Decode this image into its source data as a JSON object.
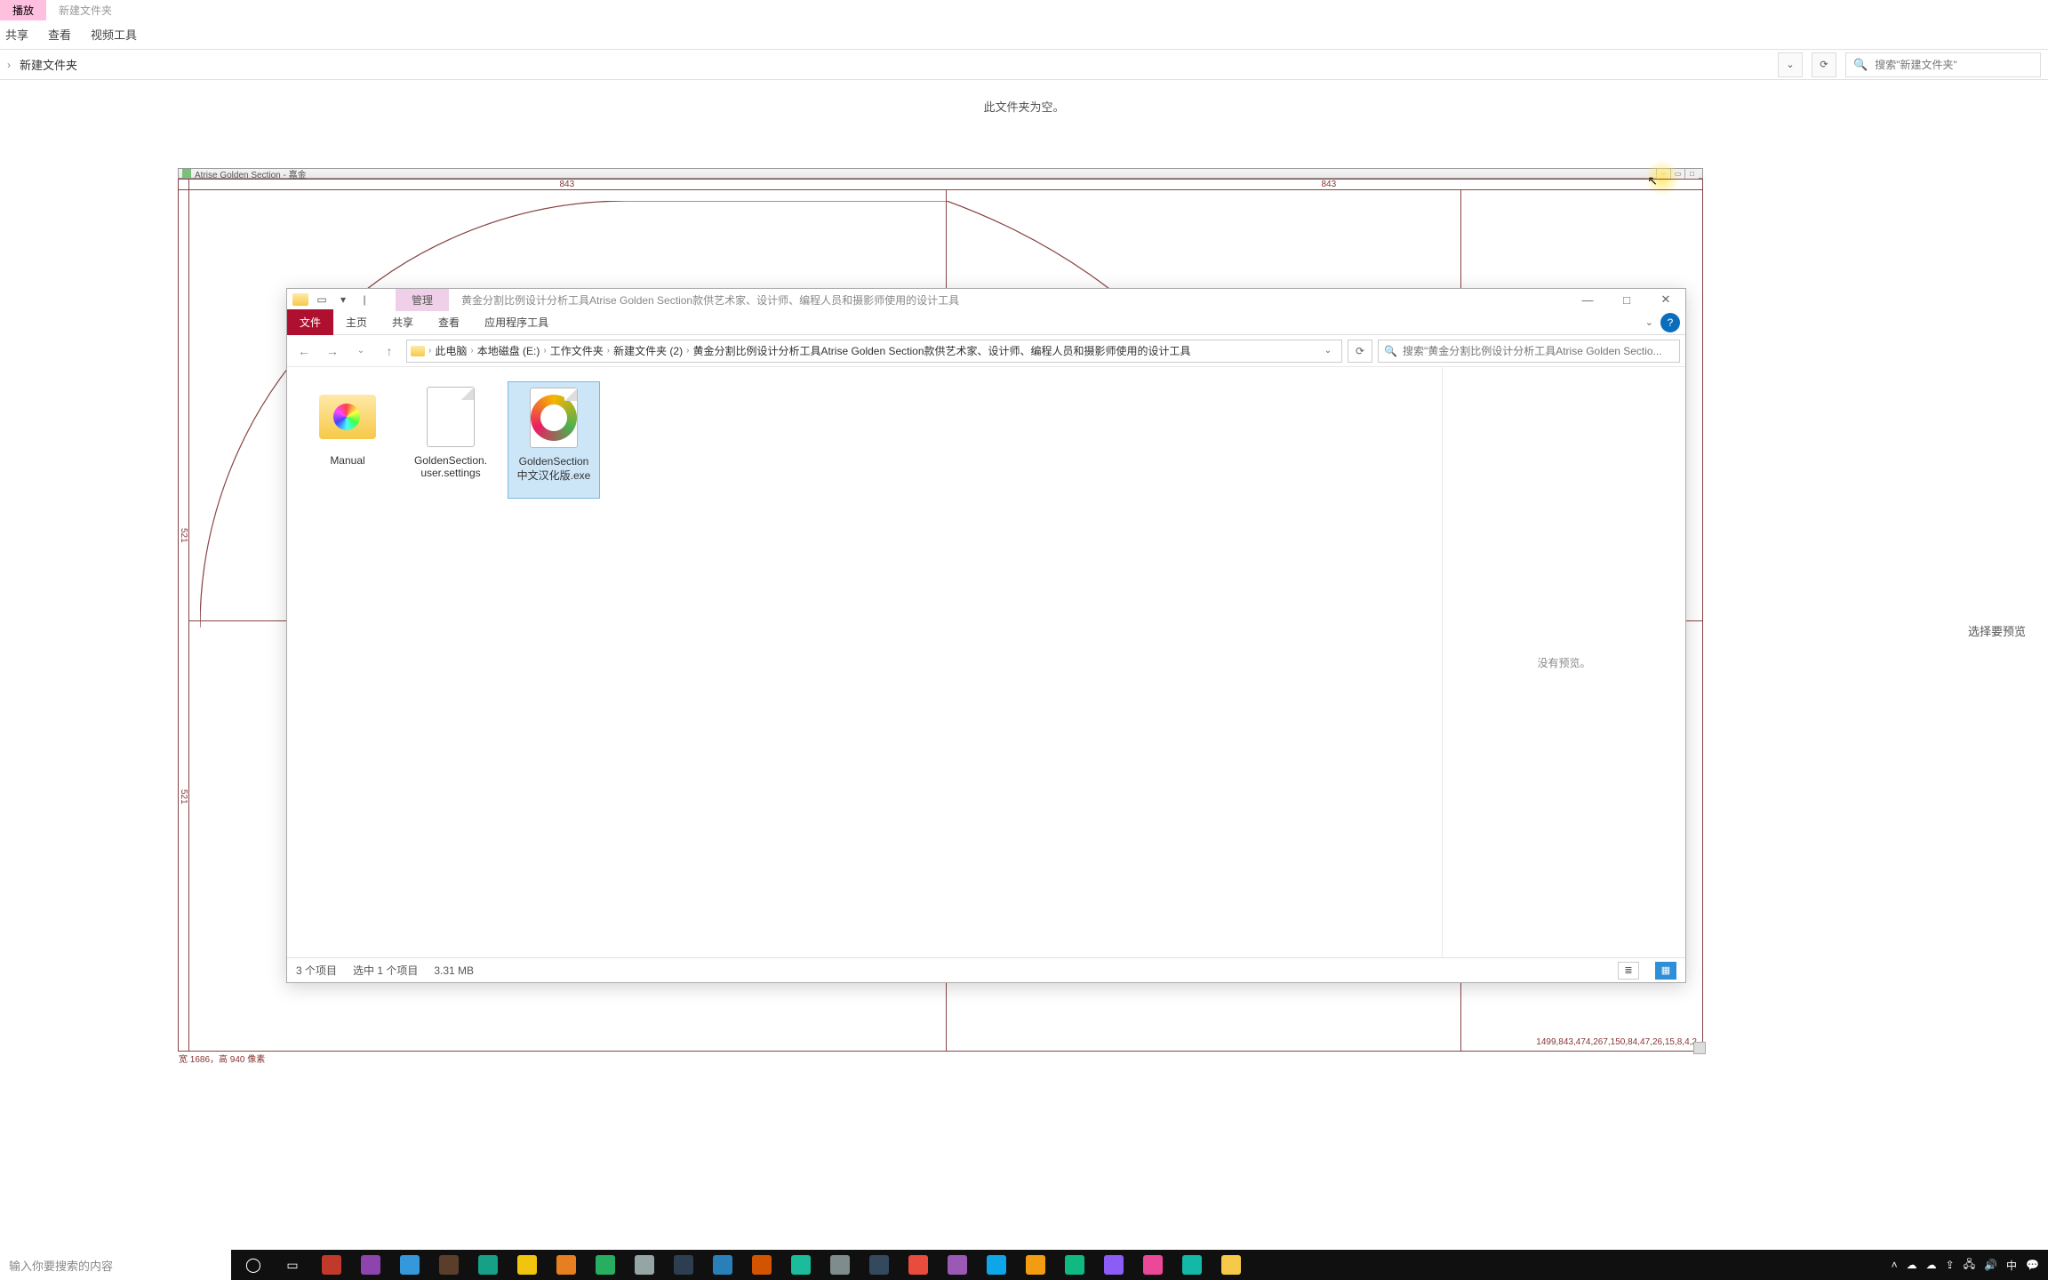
{
  "outer": {
    "tabs": {
      "play": "播放",
      "newfolder": "新建文件夹"
    },
    "subtabs": {
      "share": "共享",
      "view": "查看",
      "video": "视频工具"
    },
    "breadcrumb": "新建文件夹",
    "addr_dropdown": "⌄",
    "refresh": "⟳",
    "search_placeholder": "搜索\"新建文件夹\"",
    "empty": "此文件夹为空。",
    "preview_label": "选择要预览"
  },
  "gs": {
    "title": "Atrise Golden Section - 嘉金",
    "ruler_top": {
      "l": "843",
      "r": "843"
    },
    "ruler_left": {
      "t": "521",
      "b": "521"
    },
    "bl": "宽 1686，高  940 像素",
    "br": "1499,843,474,267,150,84,47,26,15,8,4,2",
    "win_min": "–",
    "win_max": "□",
    "win_opt": "▭"
  },
  "inner": {
    "title_tab": "管理",
    "title_text": "黄金分割比例设计分析工具Atrise Golden Section款供艺术家、设计师、编程人员和摄影师使用的设计工具",
    "ribbon": {
      "file": "文件",
      "home": "主页",
      "share": "共享",
      "view": "查看",
      "app": "应用程序工具"
    },
    "addr": {
      "pc": "此电脑",
      "drive": "本地磁盘 (E:)",
      "work": "工作文件夹",
      "newf": "新建文件夹 (2)",
      "leaf": "黄金分割比例设计分析工具Atrise Golden Section款供艺术家、设计师、编程人员和摄影师使用的设计工具"
    },
    "search_placeholder": "搜索\"黄金分割比例设计分析工具Atrise Golden Sectio...",
    "files": {
      "manual": "Manual",
      "settings_l1": "GoldenSection.",
      "settings_l2": "user.settings",
      "exe_l1": "GoldenSection",
      "exe_l2": "中文汉化版.exe"
    },
    "preview": "没有预览。",
    "status": {
      "count": "3 个项目",
      "sel": "选中 1 个项目",
      "size": "3.31 MB"
    },
    "win": {
      "min": "—",
      "max": "□",
      "close": "✕"
    }
  },
  "taskbar": {
    "search": "输入你要搜索的内容",
    "tray": {
      "ime": "中",
      "time": ""
    },
    "colors": [
      "#fff",
      "#1e1e1e",
      "#c0392b",
      "#8e44ad",
      "#3498db",
      "#5a3e2b",
      "#16a085",
      "#f1c40f",
      "#e67e22",
      "#27ae60",
      "#95a5a6",
      "#2c3e50",
      "#2980b9",
      "#d35400",
      "#1abc9c",
      "#7f8c8d",
      "#34495e",
      "#e74c3c",
      "#9b59b6",
      "#0ea5e9",
      "#f39c12",
      "#10b981",
      "#8b5cf6",
      "#ec4899",
      "#14b8a6",
      "#f7c948"
    ]
  }
}
